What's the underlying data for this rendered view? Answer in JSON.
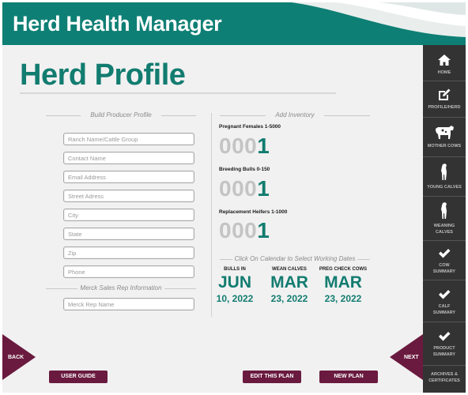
{
  "app": {
    "title": "Herd Health Manager"
  },
  "page": {
    "title": "Herd Profile"
  },
  "producer": {
    "heading": "Build Producer Profile",
    "fields": [
      {
        "placeholder": "Ranch Name/Cattle Group"
      },
      {
        "placeholder": "Contact Name"
      },
      {
        "placeholder": "Email Address"
      },
      {
        "placeholder": "Street Adress"
      },
      {
        "placeholder": "City"
      },
      {
        "placeholder": "State"
      },
      {
        "placeholder": "Zip"
      },
      {
        "placeholder": "Phone"
      }
    ],
    "rep_heading": "Merck Sales Rep Information",
    "rep_placeholder": "Merck Rep Name"
  },
  "inventory": {
    "heading": "Add Inventory",
    "items": [
      {
        "label": "Pregnant Females 1-5000",
        "zeros": "000",
        "digit": "1"
      },
      {
        "label": "Breeding Bulls 0-150",
        "zeros": "000",
        "digit": "1"
      },
      {
        "label": "Replacement Heifers 1-1000",
        "zeros": "000",
        "digit": "1"
      }
    ]
  },
  "calendar": {
    "heading": "Click On Calendar to Select Working Dates",
    "dates": [
      {
        "label": "BULLS IN",
        "month": "JUN",
        "day": "10, 2022"
      },
      {
        "label": "WEAN CALVES",
        "month": "MAR",
        "day": "23, 2022"
      },
      {
        "label": "PREG CHECK COWS",
        "month": "MAR",
        "day": "23, 2022"
      }
    ]
  },
  "sidebar": {
    "items": [
      {
        "label": "HOME",
        "icon": "home-icon"
      },
      {
        "label": "PROFILE/HERD",
        "icon": "edit-icon"
      },
      {
        "label": "MOTHER COWS",
        "icon": "cow-icon"
      },
      {
        "label": "YOUNG CALVES",
        "icon": "calf-icon"
      },
      {
        "label_line1": "WEANING",
        "label_line2": "CALVES",
        "icon": "weaning-calf-icon"
      },
      {
        "label_line1": "COW",
        "label_line2": "SUMMARY",
        "icon": "check-icon"
      },
      {
        "label_line1": "CALF",
        "label_line2": "SUMMARY",
        "icon": "check-icon"
      },
      {
        "label_line1": "PRODUCT",
        "label_line2": "SUMMARY",
        "icon": "check-icon"
      },
      {
        "label_line1": "ARCHIVES &",
        "label_line2": "CERTIFICATES"
      }
    ]
  },
  "nav": {
    "back": "BACK",
    "next": "NEXT"
  },
  "buttons": {
    "user_guide": "USER GUIDE",
    "edit_plan": "EDIT THIS PLAN",
    "new_plan": "NEW PLAN"
  },
  "colors": {
    "teal": "#127c70",
    "header": "#0e7f74",
    "maroon": "#6a1a3f",
    "sidebar": "#333333"
  }
}
